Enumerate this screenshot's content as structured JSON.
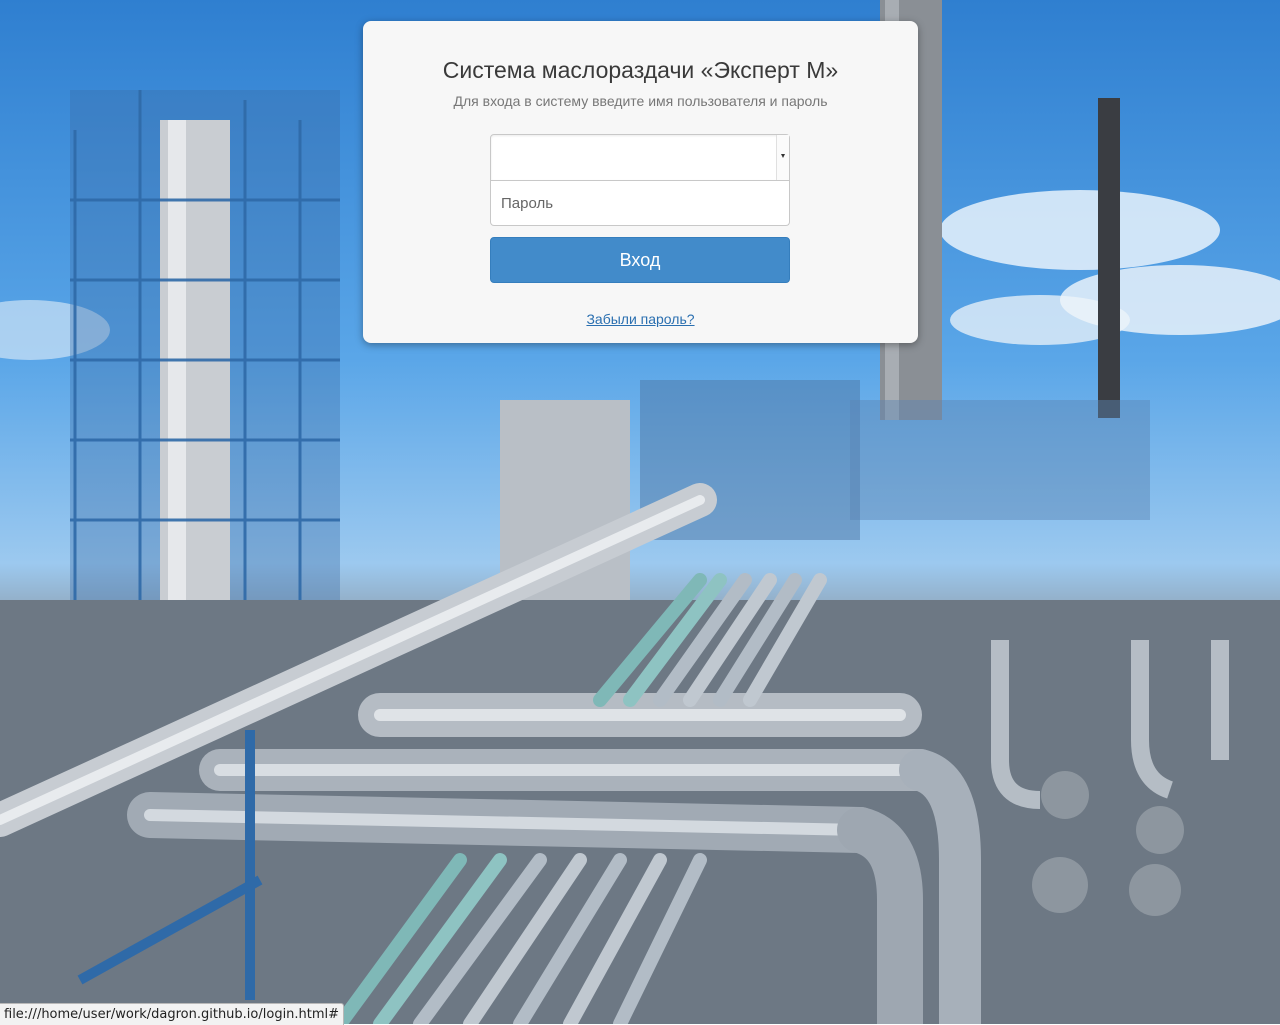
{
  "login": {
    "title": "Система маслораздачи «Эксперт М»",
    "subtitle": "Для входа в систему введите имя пользователя и пароль",
    "username_value": "",
    "password_placeholder": "Пароль",
    "submit_label": "Вход",
    "forgot_label": "Забыли пароль?"
  },
  "status_bar": {
    "url": "file:///home/user/work/dagron.github.io/login.html#"
  },
  "colors": {
    "button": "#428bca",
    "link": "#2a6fb0",
    "card": "#f7f7f7"
  }
}
